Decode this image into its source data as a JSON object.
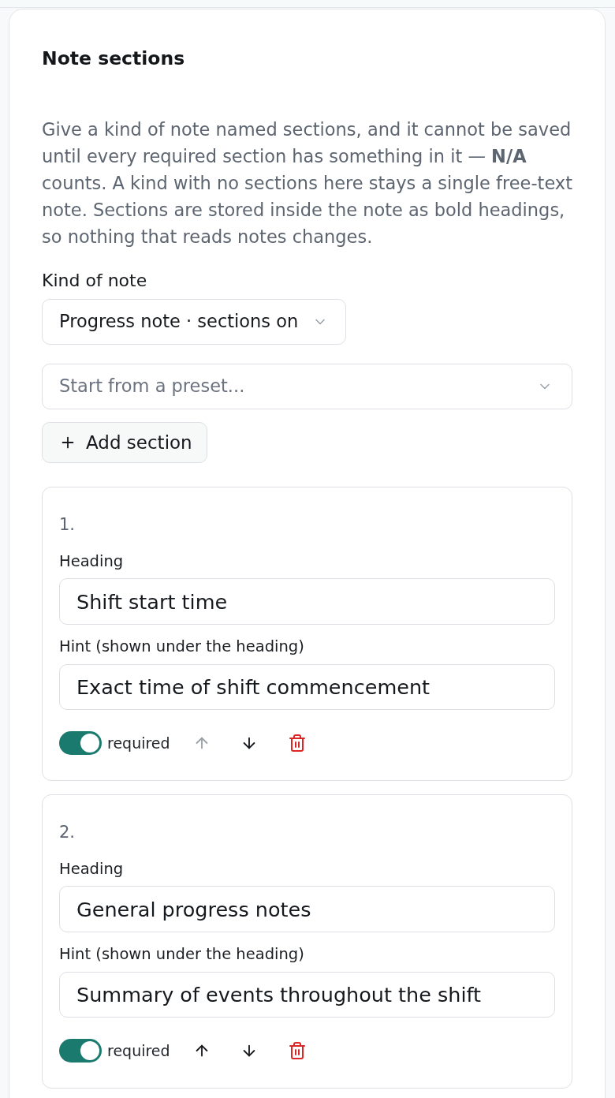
{
  "card": {
    "title": "Note sections",
    "description": "Give a kind of note named sections, and it cannot be saved until every required section has something in it — **N/A** counts. A kind with no sections here stays a single free-text note. Sections are stored inside the note as bold headings, so nothing that reads notes changes."
  },
  "kind_of_note": {
    "label": "Kind of note",
    "value": "Progress note · sections on"
  },
  "preset": {
    "placeholder": "Start from a preset..."
  },
  "add_button": {
    "label": "Add section"
  },
  "sections": [
    {
      "number": "1.",
      "fields": [
        {
          "label": "Heading",
          "value": "Shift start time"
        },
        {
          "label": "Hint (shown under the heading)",
          "value": "Exact time of shift commencement"
        }
      ],
      "on": true,
      "toggle_label": "required",
      "move_up_disabled": true,
      "move_down_disabled": false
    },
    {
      "number": "2.",
      "fields": [
        {
          "label": "Heading",
          "value": "General progress notes"
        },
        {
          "label": "Hint (shown under the heading)",
          "value": "Summary of events throughout the shift"
        }
      ],
      "on": true,
      "toggle_label": "required",
      "move_up_disabled": false,
      "move_down_disabled": false
    }
  ]
}
